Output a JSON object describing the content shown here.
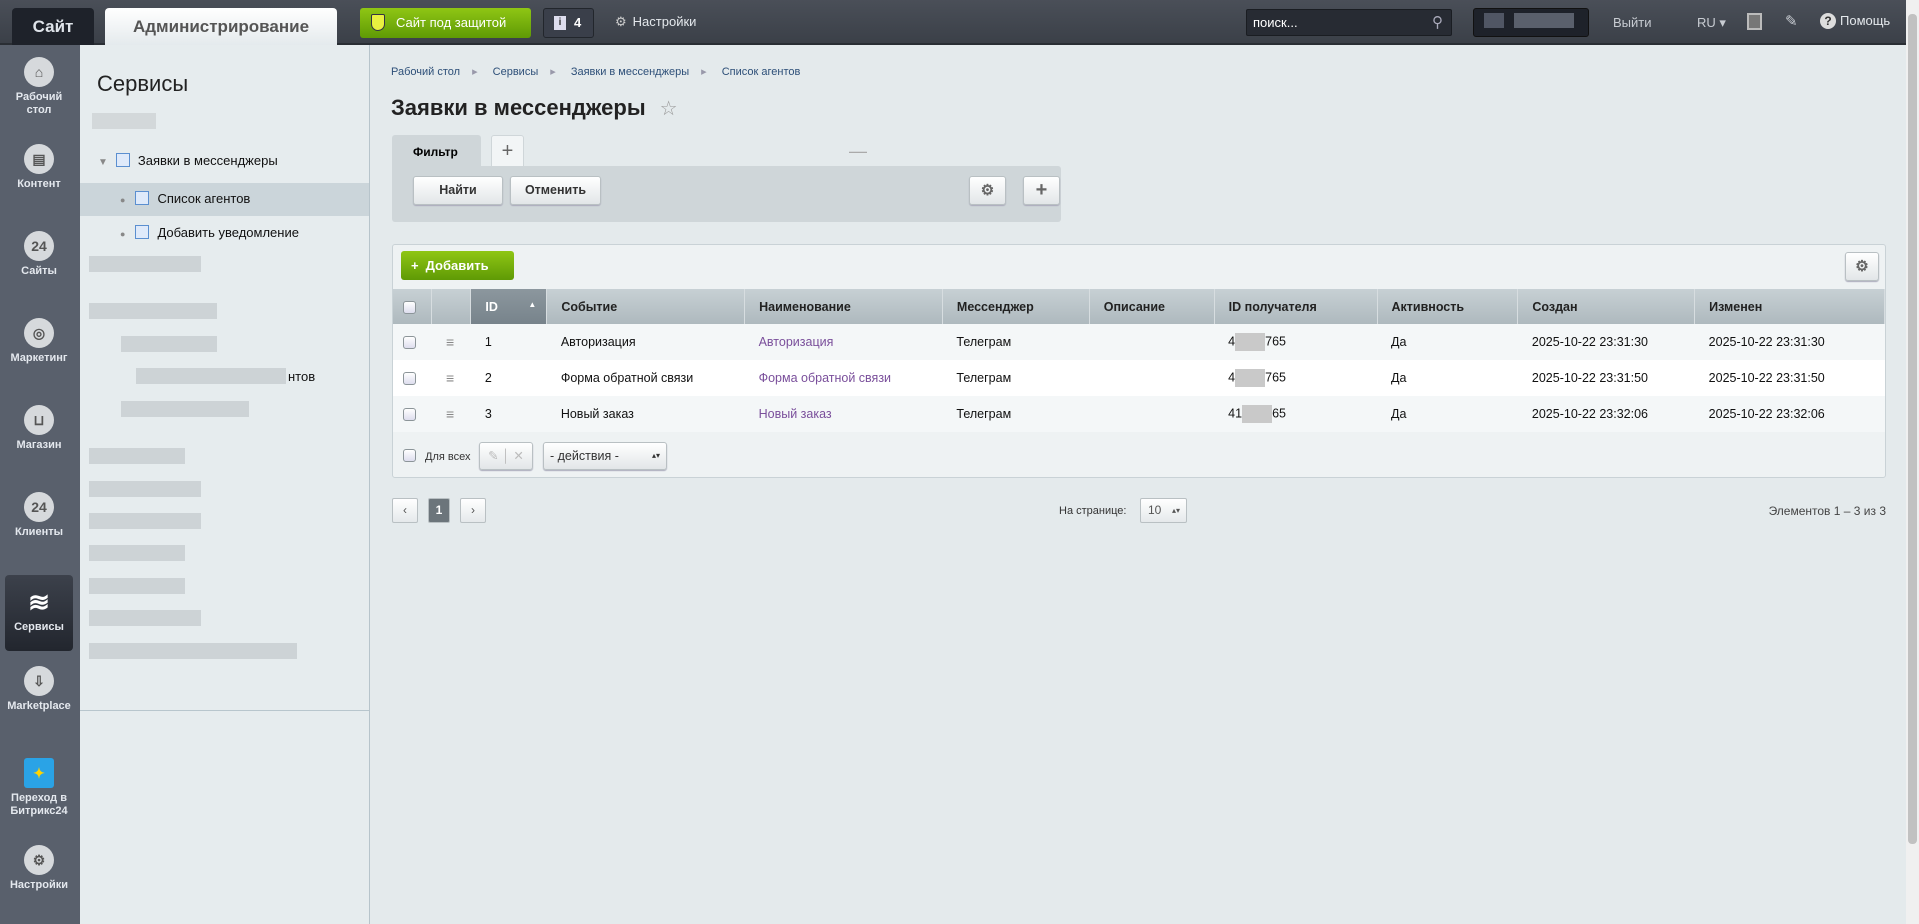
{
  "topbar": {
    "site_tab": "Сайт",
    "admin_tab": "Администрирование",
    "secure_button": "Сайт под защитой",
    "notifications_count": "4",
    "settings": "Настройки",
    "search_placeholder": "поиск...",
    "logout": "Выйти",
    "lang": "RU",
    "help": "Помощь"
  },
  "leftnav": [
    {
      "label": "Рабочий стол",
      "icon": "home-icon"
    },
    {
      "label": "Контент",
      "icon": "document-icon"
    },
    {
      "label": "Сайты",
      "icon": "calendar-24-icon"
    },
    {
      "label": "Маркетинг",
      "icon": "target-icon"
    },
    {
      "label": "Магазин",
      "icon": "basket-icon"
    },
    {
      "label": "Клиенты",
      "icon": "cloud-24-icon"
    },
    {
      "label": "Сервисы",
      "icon": "layers-icon",
      "active": true
    },
    {
      "label": "Marketplace",
      "icon": "cloud-download-icon"
    },
    {
      "label": "Переход в Битрикс24",
      "icon": "magic-wand-icon"
    },
    {
      "label": "Настройки",
      "icon": "gear-icon"
    }
  ],
  "sidebar": {
    "title": "Сервисы",
    "tree": [
      {
        "label": "Заявки в мессенджеры"
      },
      {
        "label": "Список агентов",
        "selected": true
      },
      {
        "label": "Добавить уведомление"
      }
    ],
    "partial_text": "нтов"
  },
  "breadcrumb": [
    "Рабочий стол",
    "Сервисы",
    "Заявки в мессенджеры",
    "Список агентов"
  ],
  "page_title": "Заявки в мессенджеры",
  "filter": {
    "tab": "Фильтр",
    "find": "Найти",
    "cancel": "Отменить"
  },
  "grid": {
    "add_button": "Добавить",
    "columns": [
      "ID",
      "Событие",
      "Наименование",
      "Мессенджер",
      "Описание",
      "ID получателя",
      "Активность",
      "Создан",
      "Изменен"
    ],
    "rows": [
      {
        "id": "1",
        "event": "Авторизация",
        "name": "Авторизация",
        "messenger": "Телеграм",
        "desc": "",
        "recipient_start": "4",
        "recipient_end": "765",
        "active": "Да",
        "created": "2025-10-22 23:31:30",
        "modified": "2025-10-22 23:31:30"
      },
      {
        "id": "2",
        "event": "Форма обратной связи",
        "name": "Форма обратной связи",
        "messenger": "Телеграм",
        "desc": "",
        "recipient_start": "4",
        "recipient_end": "765",
        "active": "Да",
        "created": "2025-10-22 23:31:50",
        "modified": "2025-10-22 23:31:50"
      },
      {
        "id": "3",
        "event": "Новый заказ",
        "name": "Новый заказ",
        "messenger": "Телеграм",
        "desc": "",
        "recipient_start": "41",
        "recipient_end": "65",
        "active": "Да",
        "created": "2025-10-22 23:32:06",
        "modified": "2025-10-22 23:32:06"
      }
    ],
    "for_all": "Для всех",
    "actions_select": "- действия -"
  },
  "pager": {
    "current": "1",
    "per_page_label": "На странице:",
    "per_page": "10",
    "summary": "Элементов 1 – 3 из 3"
  },
  "colors": {
    "accent_green": "#6aa80a",
    "link": "#7a4f9b",
    "nav_bg": "#59606c"
  }
}
